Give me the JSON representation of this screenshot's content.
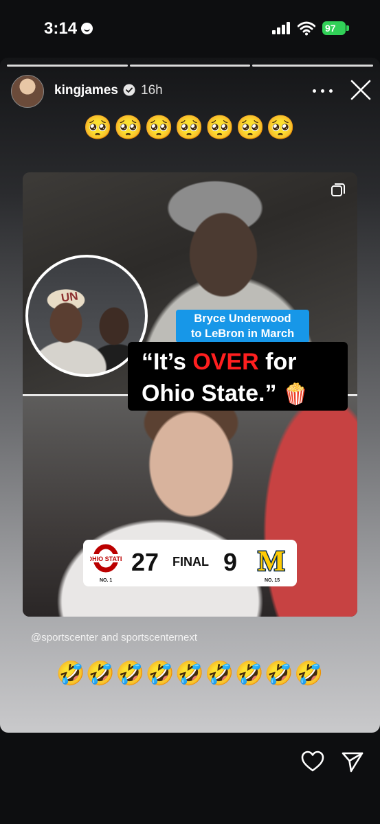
{
  "status_bar": {
    "time": "3:14",
    "battery": "97"
  },
  "story": {
    "username": "kingjames",
    "age": "16h",
    "emoji_top": "🥺🥺🥺🥺🥺🥺🥺",
    "emoji_bottom": "🤣🤣🤣🤣🤣🤣🤣🤣🤣",
    "credit_handle": "@sportscenter",
    "credit_and": "and",
    "credit_second": "sportscenternext"
  },
  "post": {
    "cap_text": "UN",
    "tag_line1": "Bryce Underwood",
    "tag_line2": "to LeBron in March",
    "quote_open": "“It’s ",
    "quote_red": "OVER",
    "quote_rest1": " for",
    "quote_line2": "Ohio State.”",
    "popcorn": "🍿",
    "score": {
      "left_team_logo": "OHIO STATE",
      "left_rank": "NO. 1",
      "left_score": "27",
      "status": "FINAL",
      "right_score": "9",
      "right_team_logo": "M",
      "right_rank": "NO. 15"
    }
  },
  "colors": {
    "accent_blue": "#1797e8",
    "quote_red": "#ff1f1f",
    "battery_green": "#31d158",
    "michigan_navy": "#00274c",
    "michigan_maize": "#ffcb05",
    "osu_red": "#bb0000"
  },
  "icons": [
    "do-not-disturb-icon",
    "signal-icon",
    "wifi-icon",
    "battery-icon",
    "verified-icon",
    "more-icon",
    "close-icon",
    "multi-photo-icon",
    "heart-icon",
    "send-icon"
  ]
}
